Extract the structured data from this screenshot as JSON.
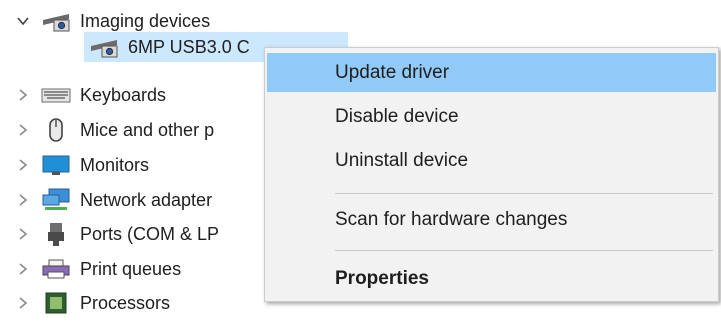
{
  "tree": {
    "items": [
      {
        "label": "Imaging devices",
        "expanded": true,
        "icon": "camera-icon"
      },
      {
        "label": "6MP USB3.0 C",
        "child": true,
        "selected": true,
        "icon": "camera-icon"
      },
      {
        "label": "Keyboards",
        "icon": "keyboard-icon"
      },
      {
        "label": "Mice and other p",
        "icon": "mouse-icon"
      },
      {
        "label": "Monitors",
        "icon": "monitor-icon"
      },
      {
        "label": "Network adapter",
        "icon": "network-icon"
      },
      {
        "label": "Ports (COM & LP",
        "icon": "port-icon"
      },
      {
        "label": "Print queues",
        "icon": "printer-icon"
      },
      {
        "label": "Processors",
        "icon": "processor-icon"
      }
    ]
  },
  "context_menu": {
    "items": [
      {
        "label": "Update driver",
        "highlighted": true
      },
      {
        "label": "Disable device"
      },
      {
        "label": "Uninstall device"
      },
      {
        "label": "Scan for hardware changes"
      },
      {
        "label": "Properties",
        "bold": true
      }
    ]
  },
  "colors": {
    "menu_background": "#f2f2f2",
    "menu_highlight": "#91c9f7",
    "selected_row": "#cce8ff",
    "text": "#1e1e1e"
  }
}
